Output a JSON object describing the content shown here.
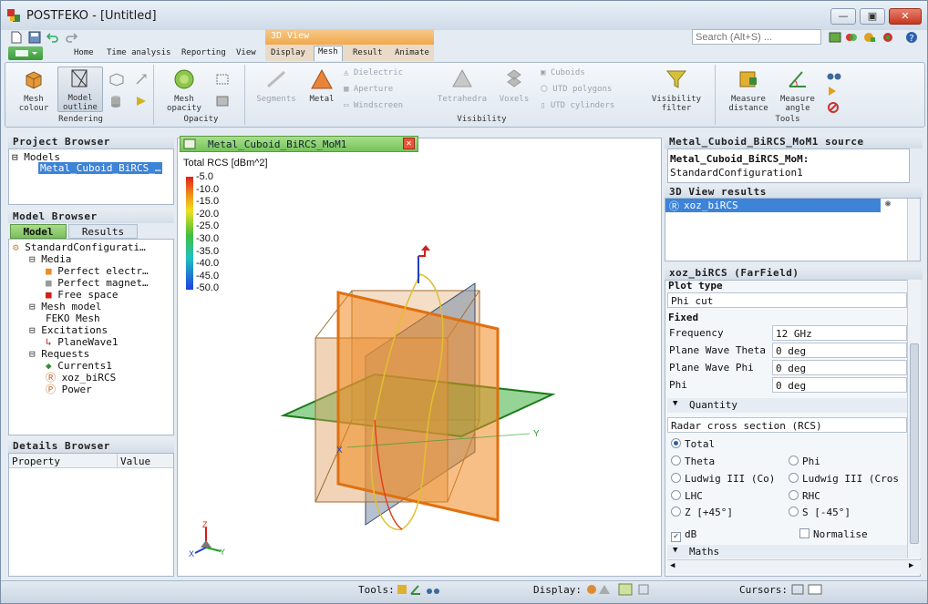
{
  "window": {
    "title": "POSTFEKO - [Untitled]",
    "min": "—",
    "max": "▣",
    "close": "✕"
  },
  "search": {
    "placeholder": "Search (Alt+S) ..."
  },
  "context_tab": {
    "label": "3D View"
  },
  "ribbon_tabs": [
    "Home",
    "Time analysis",
    "Reporting",
    "View",
    "Display",
    "Mesh",
    "Result",
    "Animate"
  ],
  "ribbon": {
    "rendering": {
      "label": "Rendering",
      "mesh_colour": "Mesh colour",
      "model_outline": "Model outline"
    },
    "opacity": {
      "label": "Opacity",
      "mesh_opacity": "Mesh opacity"
    },
    "visibility": {
      "label": "Visibility",
      "segments": "Segments",
      "metal": "Metal",
      "dielectric": "Dielectric",
      "aperture": "Aperture",
      "windscreen": "Windscreen",
      "tetrahedra": "Tetrahedra",
      "voxels": "Voxels",
      "cuboids": "Cuboids",
      "utd_polygons": "UTD polygons",
      "utd_cylinders": "UTD cylinders",
      "visibility_filter": "Visibility filter"
    },
    "tools": {
      "label": "Tools",
      "measure_distance": "Measure distance",
      "measure_angle": "Measure angle"
    }
  },
  "project_browser": {
    "title": "Project Browser",
    "root": "Models",
    "item": "Metal_Cuboid_BiRCS_…"
  },
  "model_browser": {
    "title": "Model Browser",
    "tabs": [
      "Model",
      "Results"
    ],
    "tree": [
      {
        "label": "StandardConfigurati…",
        "indent": 0
      },
      {
        "label": "Media",
        "indent": 1
      },
      {
        "label": "Perfect electr…",
        "indent": 2
      },
      {
        "label": "Perfect magnet…",
        "indent": 2
      },
      {
        "label": "Free space",
        "indent": 2
      },
      {
        "label": "Mesh model",
        "indent": 1
      },
      {
        "label": "FEKO Mesh",
        "indent": 2
      },
      {
        "label": "Excitations",
        "indent": 1
      },
      {
        "label": "PlaneWave1",
        "indent": 2
      },
      {
        "label": "Requests",
        "indent": 1
      },
      {
        "label": "Currents1",
        "indent": 2
      },
      {
        "label": "xoz_biRCS",
        "indent": 2
      },
      {
        "label": "Power",
        "indent": 2
      }
    ]
  },
  "details_browser": {
    "title": "Details Browser",
    "col_property": "Property",
    "col_value": "Value"
  },
  "view_tab": {
    "label": "Metal_Cuboid_BiRCS_MoM1"
  },
  "legend": {
    "title": "Total RCS [dBm^2]",
    "ticks": [
      "-5.0",
      "-10.0",
      "-15.0",
      "-20.0",
      "-25.0",
      "-30.0",
      "-35.0",
      "-40.0",
      "-45.0",
      "-50.0"
    ]
  },
  "axes_labels": {
    "x": "X",
    "y": "Y",
    "z": "Z"
  },
  "source_panel": {
    "title": "Metal_Cuboid_BiRCS_MoM1 source",
    "line1": "Metal_Cuboid_BiRCS_MoM:",
    "line2": "StandardConfiguration1"
  },
  "results_panel": {
    "title": "3D View results",
    "item": "xoz_biRCS"
  },
  "props": {
    "title": "xoz_biRCS (FarField)",
    "plot_type_label": "Plot type",
    "plot_type_value": "Phi cut",
    "fixed_label": "Fixed",
    "rows": [
      {
        "label": "Frequency",
        "value": "12 GHz"
      },
      {
        "label": "Plane Wave Theta",
        "value": "0 deg"
      },
      {
        "label": "Plane Wave Phi",
        "value": "0 deg"
      },
      {
        "label": "Phi",
        "value": "0 deg"
      }
    ],
    "quantity_label": "Quantity",
    "quantity_value": "Radar cross section (RCS)",
    "radios_left": [
      "Total",
      "Theta",
      "Ludwig III (Co)",
      "LHC",
      "Z [+45°]"
    ],
    "radios_right": [
      "Phi",
      "Ludwig III (Cros",
      "RHC",
      "S [-45°]"
    ],
    "db": "dB",
    "normalise": "Normalise",
    "maths": "Maths"
  },
  "status": {
    "tools": "Tools:",
    "display": "Display:",
    "cursors": "Cursors:"
  }
}
